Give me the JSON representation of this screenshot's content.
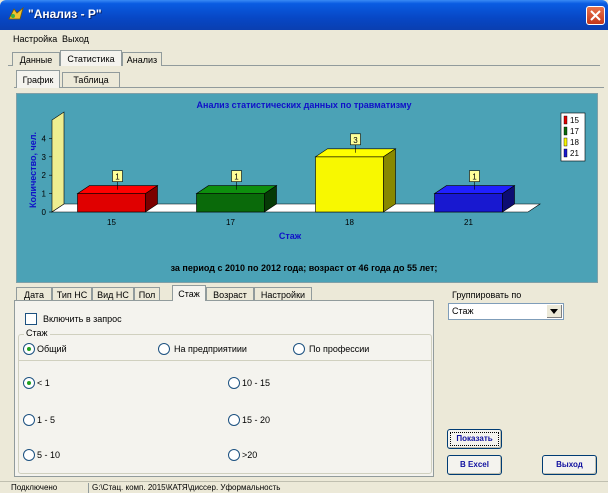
{
  "window": {
    "title": "\"Анализ - Р\""
  },
  "menu": [
    {
      "label": "Настройка"
    },
    {
      "label": "Выход"
    }
  ],
  "main_tabs": [
    {
      "label": "Данные"
    },
    {
      "label": "Статистика"
    },
    {
      "label": "Анализ"
    }
  ],
  "view_tabs": [
    {
      "label": "График"
    },
    {
      "label": "Таблица"
    }
  ],
  "chart_caption": "за период с 2010 по 2012 года; возраст от 46 года до 55 лет;",
  "chart_data": {
    "type": "bar",
    "title": "Анализ статистических данных по травматизму",
    "xlabel": "Стаж",
    "ylabel": "Количество, чел.",
    "categories": [
      "15",
      "17",
      "18",
      "21"
    ],
    "values": [
      1,
      1,
      3,
      1
    ],
    "data_labels": [
      "1",
      "1",
      "3",
      "1"
    ],
    "colors": [
      "#e00000",
      "#0a6a0a",
      "#f8f800",
      "#1818d0"
    ],
    "ylim": [
      0,
      5
    ],
    "yticks": [
      "0",
      "1",
      "2",
      "3",
      "4"
    ],
    "legend": [
      "15",
      "17",
      "18",
      "21"
    ],
    "legend_position": "top-right",
    "grid": false,
    "style": "3d"
  },
  "filter_tabs": [
    {
      "label": "Дата"
    },
    {
      "label": "Тип НС"
    },
    {
      "label": "Вид НС"
    },
    {
      "label": "Пол"
    },
    {
      "label": "Стаж"
    },
    {
      "label": "Возраст"
    },
    {
      "label": "Настройки"
    }
  ],
  "include_checkbox": {
    "label": "Включить в запрос",
    "checked": false
  },
  "group_title": "Стаж",
  "stazh_type_radios": [
    {
      "label": "Общий",
      "selected": true
    },
    {
      "label": "На предприятиии",
      "selected": false
    },
    {
      "label": "По профессии",
      "selected": false
    }
  ],
  "range_radios": [
    {
      "label": "< 1",
      "selected": true
    },
    {
      "label": "10 - 15",
      "selected": false
    },
    {
      "label": "1 - 5",
      "selected": false
    },
    {
      "label": "15 - 20",
      "selected": false
    },
    {
      "label": "5 - 10",
      "selected": false
    },
    {
      "label": ">20",
      "selected": false
    }
  ],
  "group_by": {
    "label": "Группировать по",
    "value": "Стаж"
  },
  "buttons": {
    "show": "Показать",
    "excel": "В Excel",
    "exit": "Выход"
  },
  "status": [
    {
      "text": "Подключено"
    },
    {
      "text": "G:\\Стац. комп. 2015\\КАТЯ\\диссер. Уформальность"
    }
  ]
}
